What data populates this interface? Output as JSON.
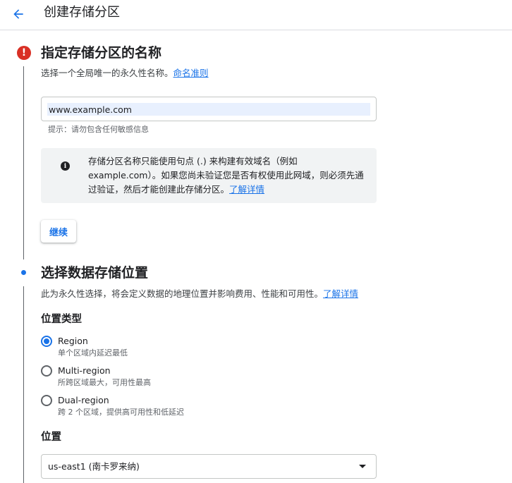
{
  "header": {
    "back_icon": "arrow-back-icon",
    "title": "创建存储分区"
  },
  "step1": {
    "status_icon": "error-icon",
    "status_symbol": "!",
    "title": "指定存储分区的名称",
    "description": "选择一个全局唯一的永久性名称。",
    "description_link": "命名准则",
    "name_input_value": "www.example.com",
    "hint": "提示：请勿包含任何敏感信息",
    "info": {
      "icon": "info-icon",
      "icon_symbol": "i",
      "text": "存储分区名称只能使用句点 (.) 来构建有效域名（例如 example.com）。如果您尚未验证您是否有权使用此网域，则必须先通过验证，然后才能创建此存储分区。",
      "link": "了解详情"
    },
    "continue_label": "继续"
  },
  "step2": {
    "status_icon": "active-step-dot-icon",
    "title": "选择数据存储位置",
    "description": "此为永久性选择，将会定义数据的地理位置并影响费用、性能和可用性。",
    "description_link": "了解详情",
    "location_type_label": "位置类型",
    "location_types": [
      {
        "label": "Region",
        "sub": "单个区域内延迟最低",
        "checked": true
      },
      {
        "label": "Multi-region",
        "sub": "所跨区域最大，可用性最高",
        "checked": false
      },
      {
        "label": "Dual-region",
        "sub": "跨 2 个区域，提供高可用性和低延迟",
        "checked": false
      }
    ],
    "location_label": "位置",
    "location_value": "us-east1 (南卡罗来纳)"
  },
  "colors": {
    "accent": "#1a73e8",
    "error": "#d93025",
    "info_bg": "#f1f3f4"
  }
}
